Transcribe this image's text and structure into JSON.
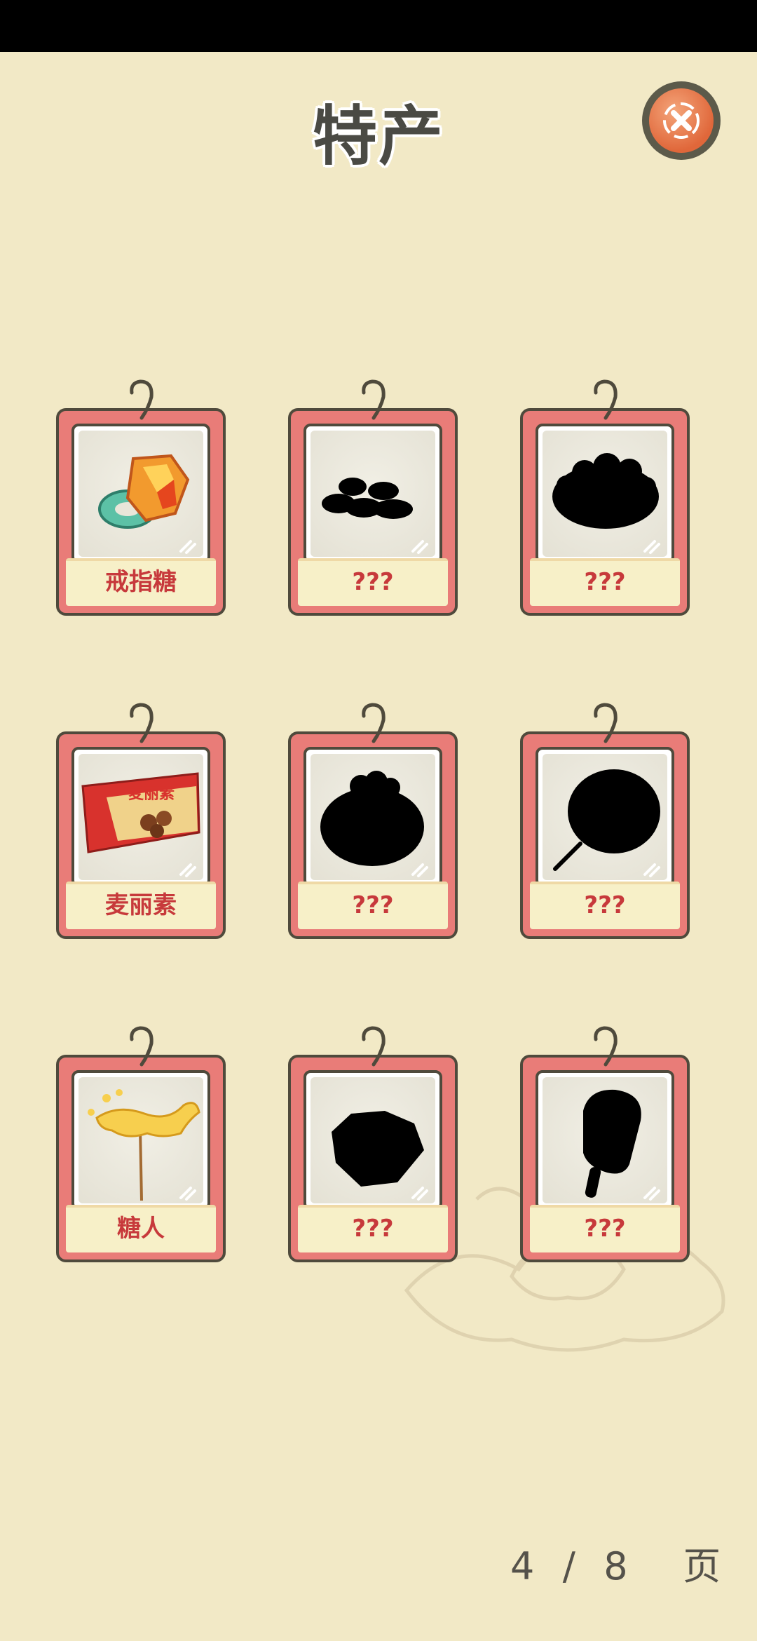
{
  "title": "特产",
  "close_icon": "close-x-icon",
  "cards": [
    {
      "label": "戒指糖",
      "icon": "ring-candy-icon",
      "unlocked": true
    },
    {
      "label": "???",
      "icon": "silhouette-snacks-icon",
      "unlocked": false
    },
    {
      "label": "???",
      "icon": "silhouette-bowl-icon",
      "unlocked": false
    },
    {
      "label": "麦丽素",
      "icon": "maltesers-bag-icon",
      "unlocked": true,
      "package_text": "麦丽素"
    },
    {
      "label": "???",
      "icon": "silhouette-bun-icon",
      "unlocked": false
    },
    {
      "label": "???",
      "icon": "silhouette-cotton-candy-icon",
      "unlocked": false
    },
    {
      "label": "糖人",
      "icon": "sugar-figure-icon",
      "unlocked": true
    },
    {
      "label": "???",
      "icon": "silhouette-pastry-icon",
      "unlocked": false
    },
    {
      "label": "???",
      "icon": "silhouette-popsicle-icon",
      "unlocked": false
    }
  ],
  "pagination": {
    "current": "4",
    "separator": "/",
    "total": "8",
    "unit": "页"
  },
  "colors": {
    "background": "#f2e9c6",
    "card_red": "#e97c78",
    "label_red": "#c7393b",
    "close_orange": "#e0673a"
  }
}
